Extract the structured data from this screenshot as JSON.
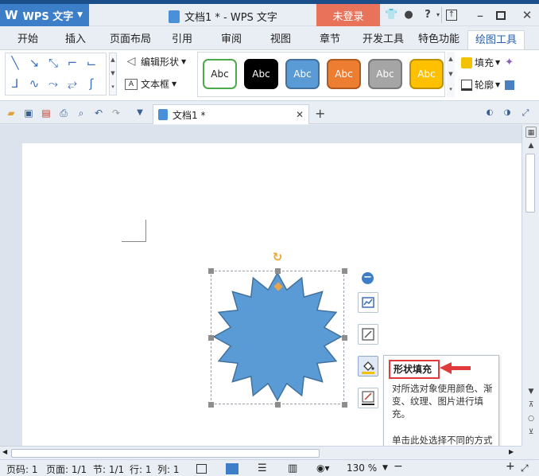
{
  "app": {
    "name": "WPS 文字",
    "doc_title": "文档1 * - WPS 文字",
    "login_label": "未登录"
  },
  "tabs": [
    "开始",
    "插入",
    "页面布局",
    "引用",
    "审阅",
    "视图",
    "章节",
    "开发工具",
    "特色功能",
    "绘图工具"
  ],
  "active_tab": "绘图工具",
  "ribbon": {
    "edit_shape": "编辑形状",
    "text_box": "文本框",
    "fill": "填充",
    "outline": "轮廓",
    "style_swatches": [
      {
        "label": "Abc",
        "fill": "#ffffff",
        "border": "#4caa4c",
        "text": "#222222"
      },
      {
        "label": "Abc",
        "fill": "#000000",
        "border": "#000000",
        "text": "#ffffff"
      },
      {
        "label": "Abc",
        "fill": "#5b9bd5",
        "border": "#41719c",
        "text": "#ffffff"
      },
      {
        "label": "Abc",
        "fill": "#ed7d31",
        "border": "#ae5a21",
        "text": "#ffffff"
      },
      {
        "label": "Abc",
        "fill": "#a5a5a5",
        "border": "#7a7a7a",
        "text": "#ffffff"
      },
      {
        "label": "Abc",
        "fill": "#ffc000",
        "border": "#bf9000",
        "text": "#ffffff"
      }
    ]
  },
  "document_tab": {
    "label": "文档1 *"
  },
  "shape": {
    "fill": "#5b9bd5",
    "stroke": "#41719c"
  },
  "tooltip": {
    "title": "形状填充",
    "description": "对所选对象使用颜色、渐变、纹理、图片进行填充。",
    "hint": "单击此处选择不同的方式进行填充。"
  },
  "status": {
    "page": "页码: 1",
    "pages": "页面: 1/1",
    "section": "节: 1/1",
    "row": "行: 1",
    "col": "列: 1",
    "zoom": "130 %"
  },
  "colors": {
    "accent": "#3c7fc8",
    "login_bg": "#e8735a",
    "highlight_red": "#e03a3a"
  }
}
